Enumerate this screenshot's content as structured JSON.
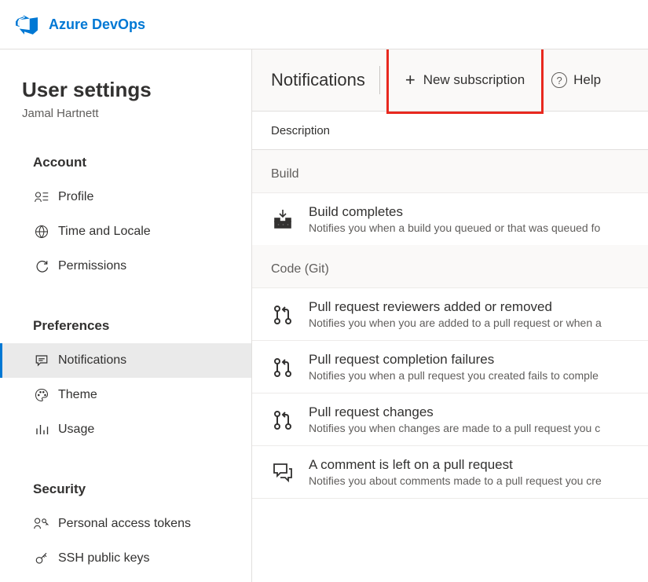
{
  "header": {
    "product": "Azure DevOps"
  },
  "sidebar": {
    "title": "User settings",
    "subtitle": "Jamal Hartnett",
    "sections": [
      {
        "label": "Account",
        "items": [
          {
            "label": "Profile"
          },
          {
            "label": "Time and Locale"
          },
          {
            "label": "Permissions"
          }
        ]
      },
      {
        "label": "Preferences",
        "items": [
          {
            "label": "Notifications"
          },
          {
            "label": "Theme"
          },
          {
            "label": "Usage"
          }
        ]
      },
      {
        "label": "Security",
        "items": [
          {
            "label": "Personal access tokens"
          },
          {
            "label": "SSH public keys"
          }
        ]
      }
    ]
  },
  "main": {
    "title": "Notifications",
    "new_subscription": "New subscription",
    "help": "Help",
    "column_header": "Description",
    "groups": [
      {
        "label": "Build",
        "items": [
          {
            "title": "Build completes",
            "desc": "Notifies you when a build you queued or that was queued fo"
          }
        ]
      },
      {
        "label": "Code (Git)",
        "items": [
          {
            "title": "Pull request reviewers added or removed",
            "desc": "Notifies you when you are added to a pull request or when a"
          },
          {
            "title": "Pull request completion failures",
            "desc": "Notifies you when a pull request you created fails to comple"
          },
          {
            "title": "Pull request changes",
            "desc": "Notifies you when changes are made to a pull request you c"
          },
          {
            "title": "A comment is left on a pull request",
            "desc": "Notifies you about comments made to a pull request you cre"
          }
        ]
      }
    ]
  }
}
